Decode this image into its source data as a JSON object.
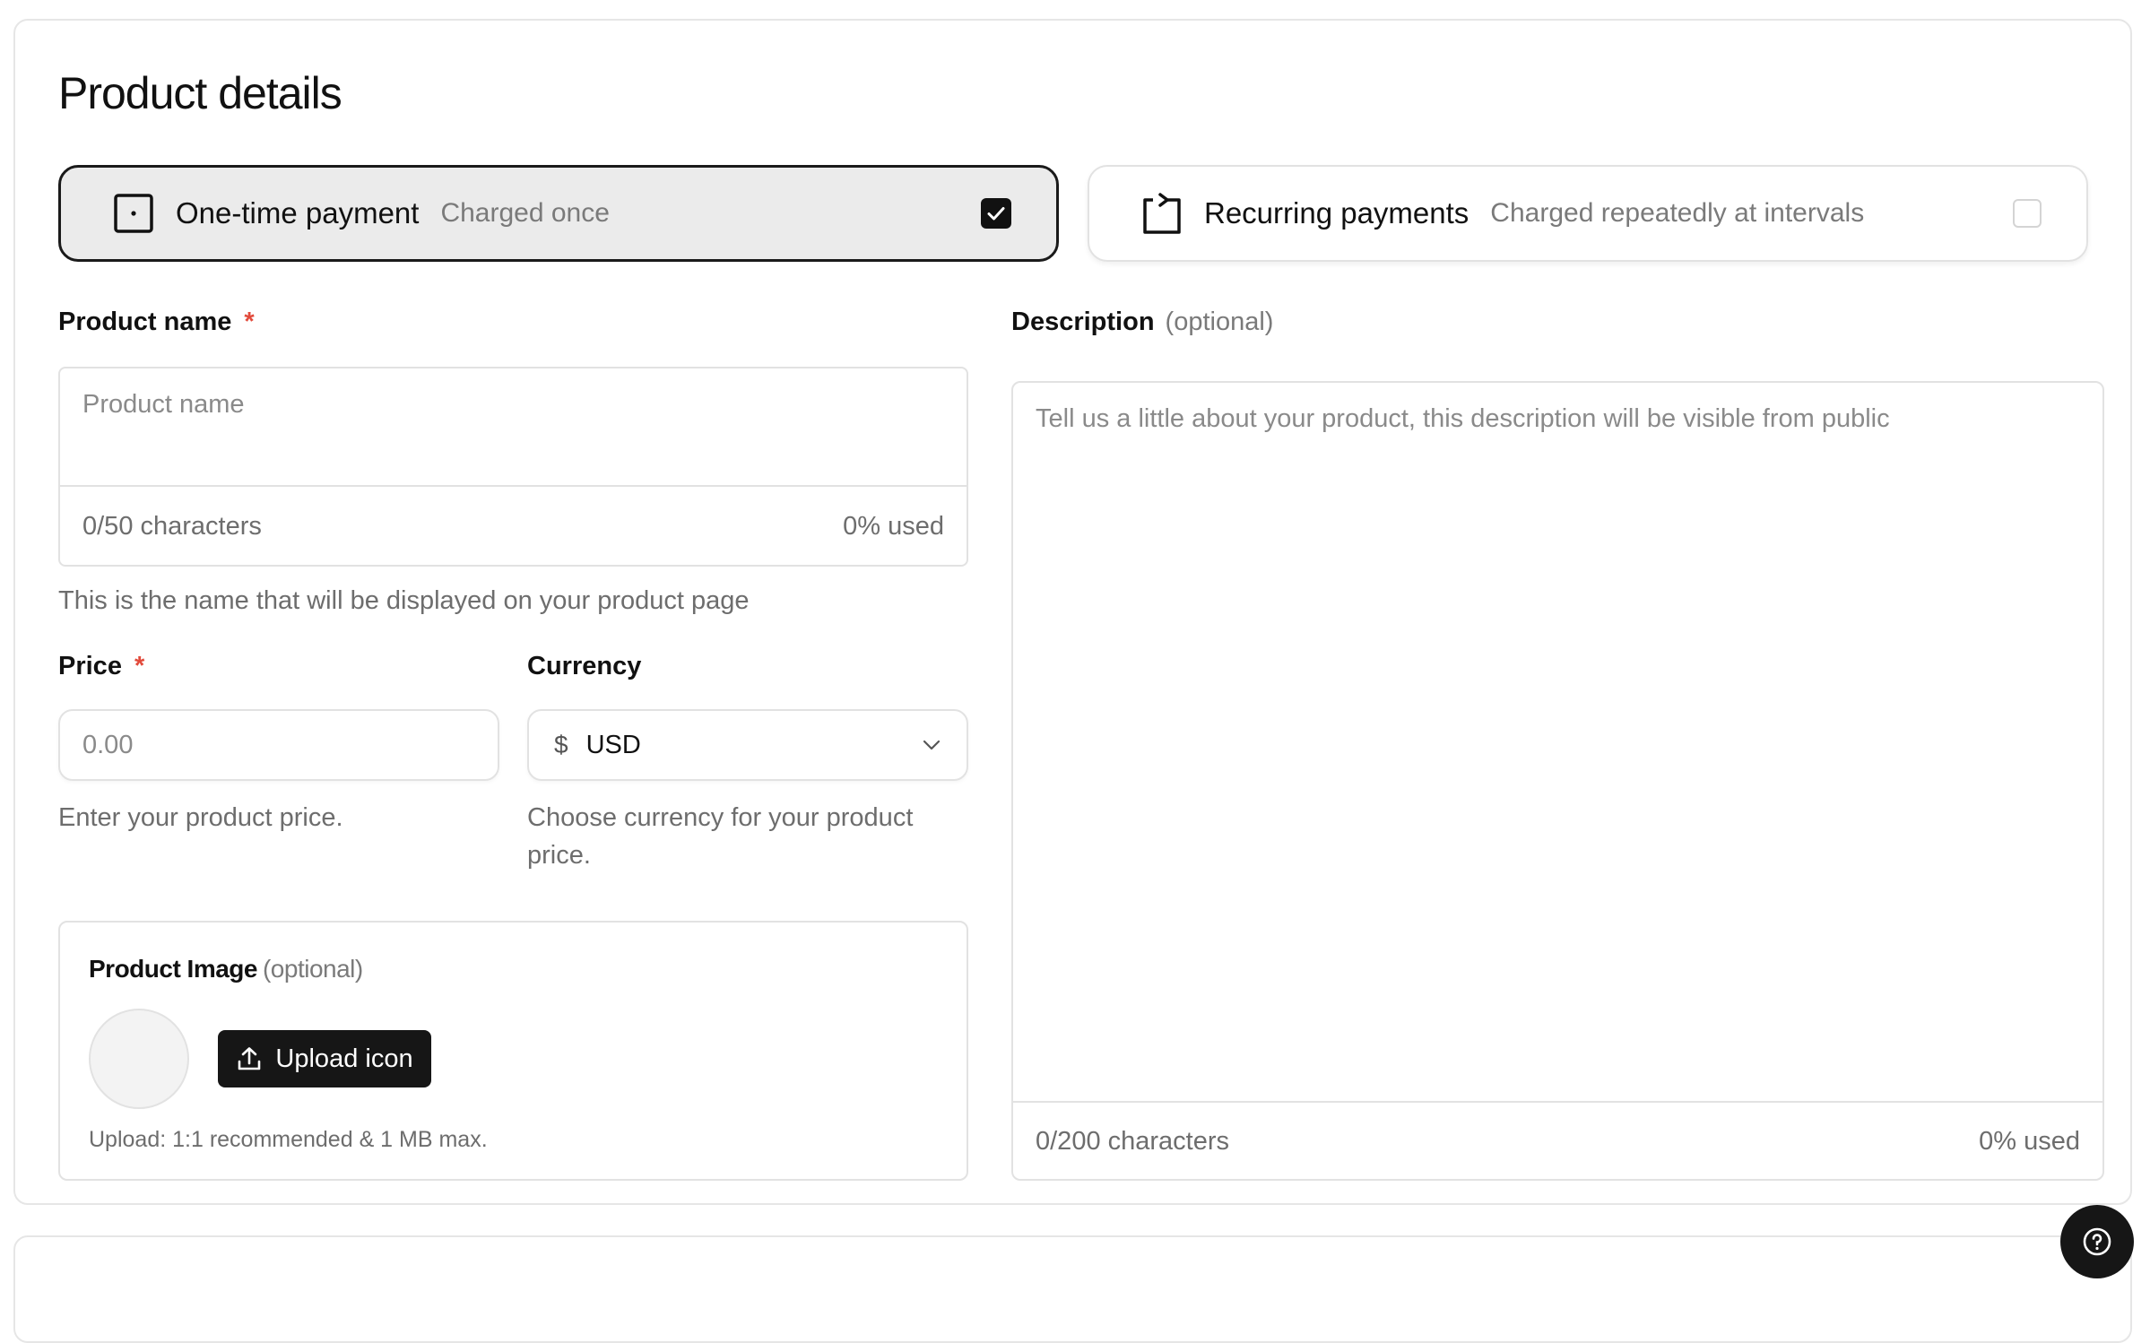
{
  "page": {
    "title": "Product details"
  },
  "payment_options": [
    {
      "label": "One-time payment",
      "sub": "Charged once",
      "selected": true
    },
    {
      "label": "Recurring payments",
      "sub": "Charged repeatedly at intervals",
      "selected": false
    }
  ],
  "product_name": {
    "label": "Product name",
    "required_mark": "*",
    "placeholder": "Product name",
    "counter": "0/50 characters",
    "usage": "0% used",
    "help": "This is the name that will be displayed on your product page"
  },
  "description": {
    "label": "Description",
    "optional": "(optional)",
    "placeholder": "Tell us a little about your product, this description will be visible from public",
    "counter": "0/200 characters",
    "usage": "0% used"
  },
  "price": {
    "label": "Price",
    "required_mark": "*",
    "placeholder": "0.00",
    "help": "Enter your product price."
  },
  "currency": {
    "label": "Currency",
    "symbol": "$",
    "selected": "USD",
    "help": "Choose currency for your product price."
  },
  "product_image": {
    "label": "Product Image",
    "optional": "(optional)",
    "button_label": "Upload icon",
    "hint": "Upload: 1:1 recommended & 1 MB max."
  },
  "next_section": {
    "title": ""
  },
  "colors": {
    "accent": "#161616",
    "required": "#e24a3b",
    "border": "#e2e2e2",
    "selected_bg": "#ebebeb"
  },
  "icons": [
    "one-time-payment-icon",
    "recurring-payment-icon",
    "checkbox-checked-icon",
    "chevron-down-icon",
    "upload-icon",
    "help-icon"
  ]
}
